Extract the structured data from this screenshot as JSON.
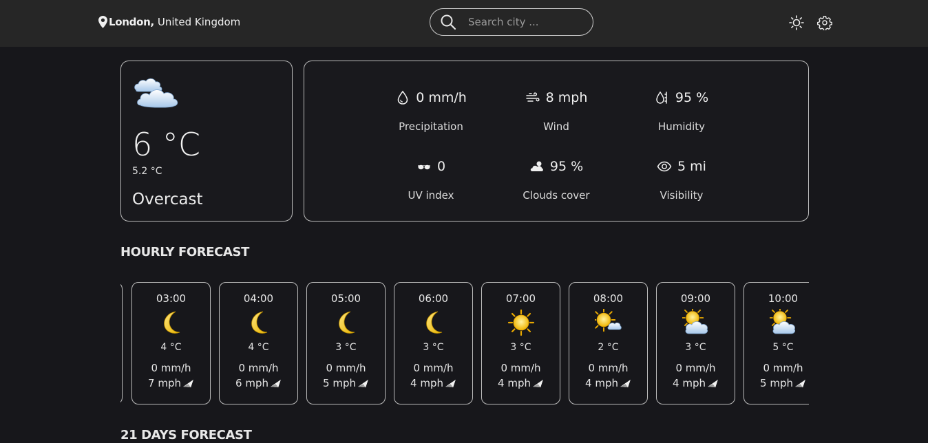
{
  "header": {
    "city": "London,",
    "country": "United Kingdom",
    "search_placeholder": "Search city ..."
  },
  "current": {
    "temperature": "6 °C",
    "feels_like": "5.2 °C",
    "condition": "Overcast",
    "icon": "cloud-icon"
  },
  "details": [
    {
      "icon": "droplet-icon",
      "value": "0 mm/h",
      "label": "Precipitation"
    },
    {
      "icon": "wind-icon",
      "value": "8 mph",
      "label": "Wind"
    },
    {
      "icon": "humidity-icon",
      "value": "95 %",
      "label": "Humidity"
    },
    {
      "icon": "sunglasses-icon",
      "value": "0",
      "label": "UV index"
    },
    {
      "icon": "cloud-sun-icon",
      "value": "95 %",
      "label": "Clouds cover"
    },
    {
      "icon": "eye-icon",
      "value": "5 mi",
      "label": "Visibility"
    }
  ],
  "hourly_title": "HOURLY FORECAST",
  "hourly": [
    {
      "time": "03:00",
      "icon": "moon-icon",
      "temp": "4 °C",
      "precip": "0 mm/h",
      "wind": "7 mph"
    },
    {
      "time": "04:00",
      "icon": "moon-icon",
      "temp": "4 °C",
      "precip": "0 mm/h",
      "wind": "6 mph"
    },
    {
      "time": "05:00",
      "icon": "moon-icon",
      "temp": "3 °C",
      "precip": "0 mm/h",
      "wind": "5 mph"
    },
    {
      "time": "06:00",
      "icon": "moon-icon",
      "temp": "3 °C",
      "precip": "0 mm/h",
      "wind": "4 mph"
    },
    {
      "time": "07:00",
      "icon": "sun-icon",
      "temp": "3 °C",
      "precip": "0 mm/h",
      "wind": "4 mph"
    },
    {
      "time": "08:00",
      "icon": "sun-cloud-icon",
      "temp": "2 °C",
      "precip": "0 mm/h",
      "wind": "4 mph"
    },
    {
      "time": "09:00",
      "icon": "partly-cloudy-icon",
      "temp": "3 °C",
      "precip": "0 mm/h",
      "wind": "4 mph"
    },
    {
      "time": "10:00",
      "icon": "partly-cloudy-icon",
      "temp": "5 °C",
      "precip": "0 mm/h",
      "wind": "5 mph"
    }
  ],
  "daily_title": "21 DAYS FORECAST"
}
